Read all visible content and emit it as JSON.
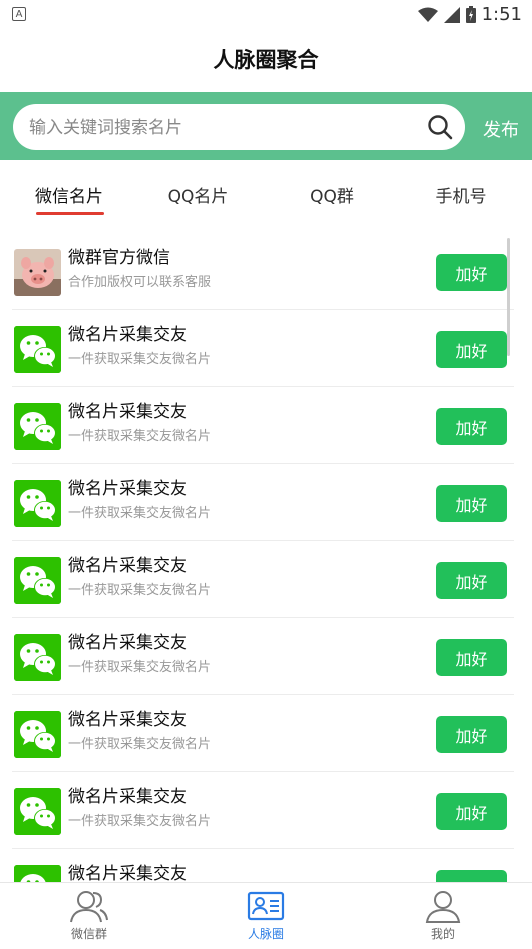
{
  "status_bar": {
    "time": "1:51",
    "notice_letter": "A"
  },
  "header": {
    "title": "人脉圈聚合"
  },
  "search": {
    "placeholder": "输入关键词搜索名片",
    "value": "",
    "publish_label": "发布"
  },
  "tabs": [
    {
      "label": "微信名片",
      "active": true
    },
    {
      "label": "QQ名片",
      "active": false
    },
    {
      "label": "QQ群",
      "active": false
    },
    {
      "label": "手机号",
      "active": false
    }
  ],
  "list": [
    {
      "title": "微群官方微信",
      "subtitle": "合作加版权可以联系客服",
      "button": "加好",
      "avatar": "pig-photo"
    },
    {
      "title": "微名片采集交友",
      "subtitle": "一件获取采集交友微名片",
      "button": "加好",
      "avatar": "wechat-icon"
    },
    {
      "title": "微名片采集交友",
      "subtitle": "一件获取采集交友微名片",
      "button": "加好",
      "avatar": "wechat-icon"
    },
    {
      "title": "微名片采集交友",
      "subtitle": "一件获取采集交友微名片",
      "button": "加好",
      "avatar": "wechat-icon"
    },
    {
      "title": "微名片采集交友",
      "subtitle": "一件获取采集交友微名片",
      "button": "加好",
      "avatar": "wechat-icon"
    },
    {
      "title": "微名片采集交友",
      "subtitle": "一件获取采集交友微名片",
      "button": "加好",
      "avatar": "wechat-icon"
    },
    {
      "title": "微名片采集交友",
      "subtitle": "一件获取采集交友微名片",
      "button": "加好",
      "avatar": "wechat-icon"
    },
    {
      "title": "微名片采集交友",
      "subtitle": "一件获取采集交友微名片",
      "button": "加好",
      "avatar": "wechat-icon"
    },
    {
      "title": "微名片采集交友",
      "subtitle": "",
      "button": "加好",
      "avatar": "wechat-icon"
    }
  ],
  "bottom_nav": [
    {
      "label": "微信群",
      "icon": "users-icon",
      "active": false
    },
    {
      "label": "人脉圈",
      "icon": "contact-card-icon",
      "active": true
    },
    {
      "label": "我的",
      "icon": "person-icon",
      "active": false
    }
  ],
  "colors": {
    "search_bar_bg": "#5cc08e",
    "add_button": "#22c05a",
    "tab_underline": "#e03c31",
    "nav_active": "#2a7be4",
    "wechat_green": "#2dc100"
  }
}
